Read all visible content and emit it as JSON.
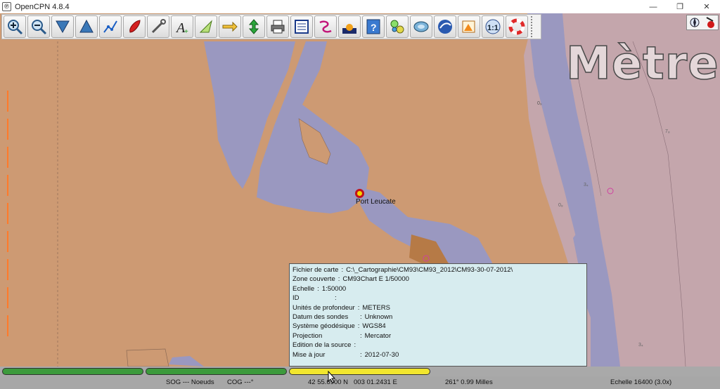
{
  "window": {
    "title": "OpenCPN 4.8.4",
    "app_icon_glyph": "℗",
    "minimize_glyph": "—",
    "restore_glyph": "❐",
    "close_glyph": "✕"
  },
  "toolbar": {
    "buttons": [
      {
        "icon": "zoom-in-icon"
      },
      {
        "icon": "zoom-out-icon"
      },
      {
        "icon": "scale-in-icon"
      },
      {
        "icon": "scale-out-icon"
      },
      {
        "icon": "route-icon"
      },
      {
        "icon": "track-icon"
      },
      {
        "icon": "settings-icon"
      },
      {
        "icon": "text-icon"
      },
      {
        "icon": "ais-icon"
      },
      {
        "icon": "currents-icon"
      },
      {
        "icon": "tides-icon"
      },
      {
        "icon": "print-icon"
      },
      {
        "icon": "route-manager-icon"
      },
      {
        "icon": "track-manager-icon"
      },
      {
        "icon": "color-scheme-icon"
      },
      {
        "icon": "help-icon"
      },
      {
        "icon": "plugin-icon"
      },
      {
        "icon": "globe-icon"
      },
      {
        "icon": "earth-icon"
      },
      {
        "icon": "chart-info-icon"
      },
      {
        "icon": "scale-one-to-one-icon"
      },
      {
        "icon": "mob-icon"
      }
    ],
    "scale_label": "1:1"
  },
  "chart_overlay": {
    "units_text": "Mètres",
    "place_name": "Port Leucate",
    "soundings": [
      "0₉",
      "7₈",
      "3₄",
      "0₈",
      "3₄"
    ]
  },
  "info_popup": {
    "rows": [
      {
        "label": "Fichier de carte",
        "value": "C:\\_Cartographie\\CM93\\CM93_2012\\CM93-30-07-2012\\"
      },
      {
        "label": "Zone couverte",
        "value": "CM93Chart E  1/50000"
      },
      {
        "label": "Echelle",
        "value": "1:50000"
      },
      {
        "label": "ID",
        "value": ""
      },
      {
        "label": "Unités de profondeur",
        "value": "METERS"
      },
      {
        "label": "Datum des sondes",
        "value": "Unknown"
      },
      {
        "label": "Système géodésique",
        "value": "WGS84"
      },
      {
        "label": "Projection",
        "value": "Mercator"
      },
      {
        "label": "Edition de la source",
        "value": ""
      },
      {
        "label": "Mise à jour",
        "value": "2012-07-30"
      }
    ]
  },
  "piano": {
    "keys": [
      {
        "color": "#3c9a3c",
        "state": "inactive"
      },
      {
        "color": "#3c9a3c",
        "state": "inactive"
      },
      {
        "color": "#f2e62e",
        "state": "active"
      }
    ]
  },
  "status": {
    "sog": "SOG --- Noeuds",
    "cog": "COG ---°",
    "lat": "42 55.6900 N",
    "lon": "003 01.2431 E",
    "bearing_dist": "261°  0.99 Milles",
    "scale": "Echelle 16400 (3.0x)"
  },
  "colors": {
    "land": "#cd9a73",
    "water": "#9a98c0",
    "shallow_water": "#c4a6ac",
    "popup_bg": "#d7ecef",
    "piano_green": "#3c9a3c",
    "piano_yellow": "#f2e62e"
  }
}
